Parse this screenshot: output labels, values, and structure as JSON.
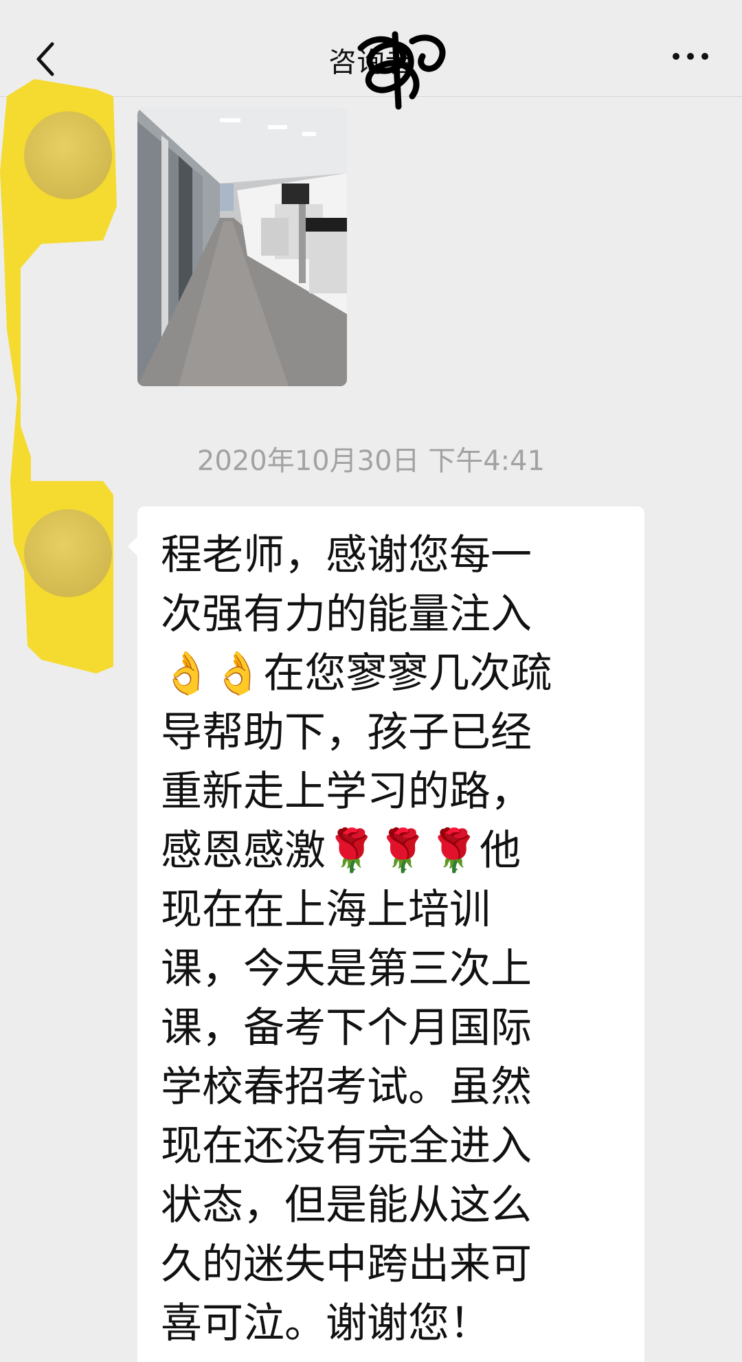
{
  "header": {
    "title": "咨询者",
    "back_icon": "chevron-left-icon",
    "more_icon": "more-dots-icon"
  },
  "messages": {
    "timestamp": "2020年10月30日 下午4:41",
    "text_lines": [
      "程老师，感谢您每一",
      "次强有力的能量注入",
      "👌👌在您寥寥几次疏",
      "导帮助下，孩子已经",
      "重新走上学习的路，",
      "感恩感激🌹🌹🌹他",
      "现在在上海上培训",
      "课，今天是第三次上",
      "课，备考下个月国际",
      "学校春招考试。虽然",
      "现在还没有完全进入",
      "状态，但是能从这么",
      "久的迷失中跨出来可",
      "喜可泣。谢谢您！"
    ]
  },
  "colors": {
    "background": "#ededed",
    "bubble": "#ffffff",
    "highlight": "#f5d81e",
    "timestamp": "#a2a2a2"
  }
}
